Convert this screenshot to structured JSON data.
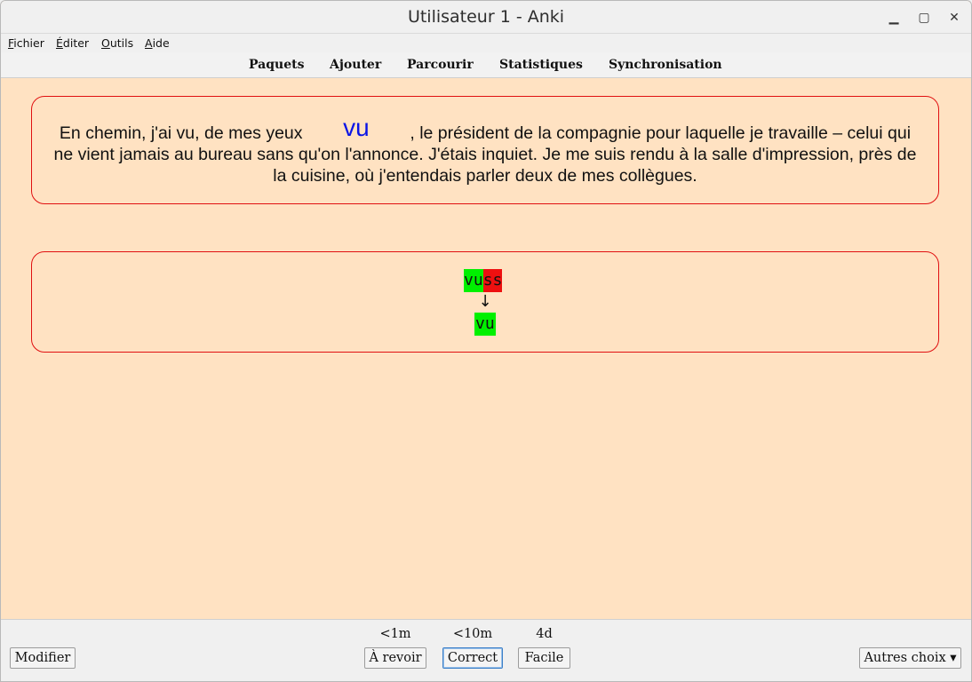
{
  "window": {
    "title": "Utilisateur 1 - Anki",
    "minimize_glyph": "▁",
    "maximize_glyph": "▢",
    "close_glyph": "✕"
  },
  "menubar": {
    "items": [
      {
        "underline": "F",
        "rest": "ichier"
      },
      {
        "underline": "É",
        "rest": "diter"
      },
      {
        "underline": "O",
        "rest": "utils"
      },
      {
        "underline": "A",
        "rest": "ide"
      }
    ]
  },
  "toolbar": {
    "links": [
      "Paquets",
      "Ajouter",
      "Parcourir",
      "Statistiques",
      "Synchronisation"
    ]
  },
  "card": {
    "sentence_before": "En chemin, j'ai vu, de mes yeux ",
    "cloze_answer": "vu",
    "sentence_after": " , le président de la compagnie pour laquelle je travaille – celui qui ne vient jamais au bureau sans qu'on l'annonce. J'étais inquiet. Je me suis rendu à la salle d'impression, près de la cuisine, où j'entendais parler deux de mes collègues.",
    "typed_correct_part": "vu",
    "typed_wrong_part": "ss",
    "arrow": "↓",
    "expected_answer": "vu"
  },
  "colors": {
    "background": "#ffe2c2",
    "card_border": "#e01010",
    "cloze_color": "#0a14e6",
    "correct_highlight": "#00f000",
    "wrong_highlight": "#ee1010"
  },
  "bottombar": {
    "edit_label": "Modifier",
    "more_label": "Autres choix ▾",
    "answers": [
      {
        "interval": "<1m",
        "label": "À revoir"
      },
      {
        "interval": "<10m",
        "label": "Correct"
      },
      {
        "interval": "4d",
        "label": "Facile"
      }
    ]
  }
}
